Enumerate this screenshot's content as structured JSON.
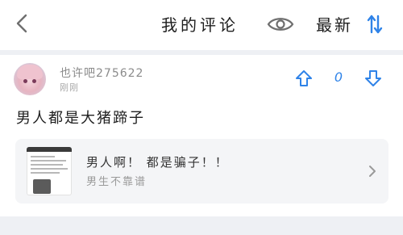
{
  "header": {
    "title": "我的评论",
    "sort_label": "最新",
    "back_icon": "back-chevron-icon",
    "eye_icon": "eye-icon",
    "sort_icon": "sort-arrows-icon"
  },
  "comment": {
    "username": "也许吧275622",
    "timestamp": "刚刚",
    "text": "男人都是大猪蹄子",
    "votes": "0",
    "upvote_icon": "arrow-up-icon",
    "downvote_icon": "arrow-down-icon"
  },
  "post": {
    "title": "男人啊！ 都是骗子！！",
    "forum": "男生不靠谱",
    "chevron_icon": "chevron-right-icon"
  },
  "colors": {
    "accent": "#2f83e8",
    "divider": "#eef0f4",
    "card_bg": "#f4f5f7"
  }
}
